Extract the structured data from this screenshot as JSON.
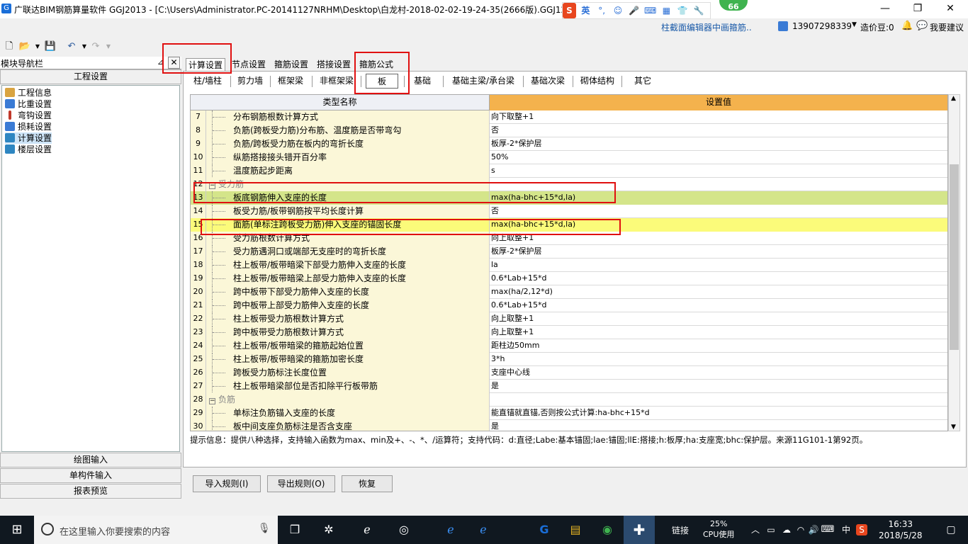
{
  "window": {
    "title": "广联达BIM钢筋算量软件 GGJ2013 - [C:\\Users\\Administrator.PC-20141127NRHM\\Desktop\\白龙村-2018-02-02-19-24-35(2666版).GGJ12]",
    "icon_letter": "G"
  },
  "ime": {
    "brand": "S",
    "lang": "英",
    "badge": "66"
  },
  "header_right": {
    "editor_hint": "柱截面编辑器中画箍筋..",
    "phone": "13907298339",
    "cost": "造价豆:0",
    "suggest": "我要建议"
  },
  "nav": {
    "title": "模块导航栏",
    "section_top": "工程设置",
    "tree": [
      {
        "label": "工程信息",
        "color": "#d9a441"
      },
      {
        "label": "比重设置",
        "color": "#3a7bd5"
      },
      {
        "label": "弯钩设置",
        "color": "#c0392b"
      },
      {
        "label": "损耗设置",
        "color": "#3a7bd5"
      },
      {
        "label": "计算设置",
        "color": "#2e86c1"
      },
      {
        "label": "楼层设置",
        "color": "#2e86c1"
      }
    ],
    "sections_bottom": [
      "绘图输入",
      "单构件输入",
      "报表预览"
    ]
  },
  "tabs_top": [
    "计算设置",
    "节点设置",
    "箍筋设置",
    "搭接设置",
    "箍筋公式"
  ],
  "tabs_sub": [
    "柱/墙柱",
    "剪力墙",
    "框架梁",
    "非框架梁",
    "板",
    "基础",
    "基础主梁/承台梁",
    "基础次梁",
    "砌体结构",
    "其它"
  ],
  "grid": {
    "col_name": "类型名称",
    "col_value": "设置值",
    "rows": [
      {
        "no": "7",
        "name": "分布钢筋根数计算方式",
        "value": "向下取整+1"
      },
      {
        "no": "8",
        "name": "负筋(跨板受力筋)分布筋、温度筋是否带弯勾",
        "value": "否"
      },
      {
        "no": "9",
        "name": "负筋/跨板受力筋在板内的弯折长度",
        "value": "板厚-2*保护层"
      },
      {
        "no": "10",
        "name": "纵筋搭接接头错开百分率",
        "value": "50%"
      },
      {
        "no": "11",
        "name": "温度筋起步距离",
        "value": "s"
      },
      {
        "no": "12",
        "name": "受力筋",
        "value": "",
        "cat": true
      },
      {
        "no": "13",
        "name": "板底钢筋伸入支座的长度",
        "value": "max(ha-bhc+15*d,la)",
        "hl": "green"
      },
      {
        "no": "14",
        "name": "板受力筋/板带钢筋按平均长度计算",
        "value": "否"
      },
      {
        "no": "15",
        "name": "面筋(单标注跨板受力筋)伸入支座的锚固长度",
        "value": "max(ha-bhc+15*d,la)",
        "hl": "yellow"
      },
      {
        "no": "16",
        "name": "受力筋根数计算方式",
        "value": "向上取整+1"
      },
      {
        "no": "17",
        "name": "受力筋遇洞口或端部无支座时的弯折长度",
        "value": "板厚-2*保护层"
      },
      {
        "no": "18",
        "name": "柱上板带/板带暗梁下部受力筋伸入支座的长度",
        "value": "la"
      },
      {
        "no": "19",
        "name": "柱上板带/板带暗梁上部受力筋伸入支座的长度",
        "value": "0.6*Lab+15*d"
      },
      {
        "no": "20",
        "name": "跨中板带下部受力筋伸入支座的长度",
        "value": "max(ha/2,12*d)"
      },
      {
        "no": "21",
        "name": "跨中板带上部受力筋伸入支座的长度",
        "value": "0.6*Lab+15*d"
      },
      {
        "no": "22",
        "name": "柱上板带受力筋根数计算方式",
        "value": "向上取整+1"
      },
      {
        "no": "23",
        "name": "跨中板带受力筋根数计算方式",
        "value": "向上取整+1"
      },
      {
        "no": "24",
        "name": "柱上板带/板带暗梁的箍筋起始位置",
        "value": "距柱边50mm"
      },
      {
        "no": "25",
        "name": "柱上板带/板带暗梁的箍筋加密长度",
        "value": "3*h"
      },
      {
        "no": "26",
        "name": "跨板受力筋标注长度位置",
        "value": "支座中心线"
      },
      {
        "no": "27",
        "name": "柱上板带暗梁部位是否扣除平行板带筋",
        "value": "是"
      },
      {
        "no": "28",
        "name": "负筋",
        "value": "",
        "cat": true
      },
      {
        "no": "29",
        "name": "单标注负筋锚入支座的长度",
        "value": "能直锚就直锚,否则按公式计算:ha-bhc+15*d"
      },
      {
        "no": "30",
        "name": "板中间支座负筋标注是否含支座",
        "value": "是"
      }
    ]
  },
  "tip": "提示信息：提供八种选择，支持输入函数为max、min及+、-、*、/运算符；支持代码：d:直径;Labe:基本锚固;lae:锚固;llE:搭接;h:板厚;ha:支座宽;bhc:保护层。来源11G101-1第92页。",
  "buttons": {
    "import": "导入规则(I)",
    "export": "导出规则(O)",
    "restore": "恢复"
  },
  "taskbar": {
    "search_placeholder": "在这里输入你要搜索的内容",
    "link": "链接",
    "cpu_pct": "25%",
    "cpu_label": "CPU使用",
    "ime": "中",
    "time": "16:33",
    "date": "2018/5/28"
  },
  "colors": {
    "accent": "#f4b24d",
    "highlight_green": "#d4e58a",
    "highlight_yellow": "#fbfb7a",
    "annotation_red": "#e01010"
  }
}
